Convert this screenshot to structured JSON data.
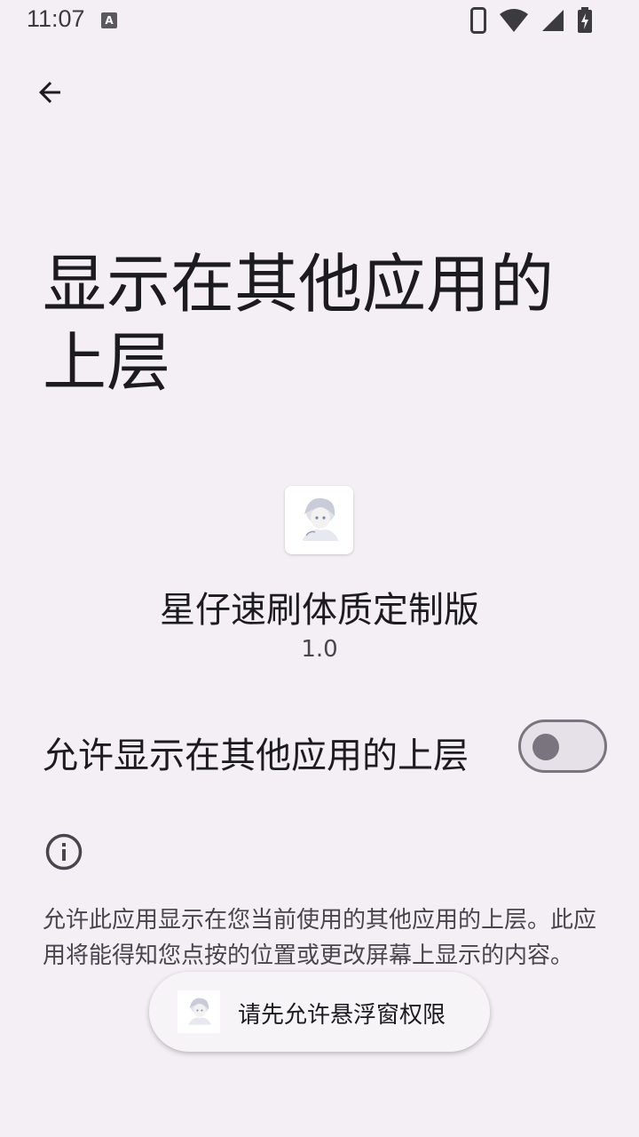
{
  "status_bar": {
    "time": "11:07",
    "notification_icon": "a-icon",
    "icons": [
      "phone-icon",
      "wifi-icon",
      "signal-icon",
      "battery-charging-icon"
    ]
  },
  "toolbar": {
    "back_icon": "arrow-back-icon"
  },
  "page": {
    "title": "显示在其他应用的上层"
  },
  "app": {
    "icon": "app-avatar-icon",
    "name": "星仔速刷体质定制版",
    "version": "1.0"
  },
  "permission": {
    "label": "允许显示在其他应用的上层",
    "enabled": false
  },
  "info": {
    "icon": "info-icon",
    "description": "允许此应用显示在您当前使用的其他应用的上层。此应用将能得知您点按的位置或更改屏幕上显示的内容。"
  },
  "toast": {
    "icon": "app-avatar-icon",
    "message": "请先允许悬浮窗权限"
  },
  "colors": {
    "background": "#f4eff4",
    "text_primary": "#1c1b1f",
    "text_secondary": "#49454f",
    "toggle_outline": "#79747e",
    "toggle_track": "#e6e0e9"
  }
}
